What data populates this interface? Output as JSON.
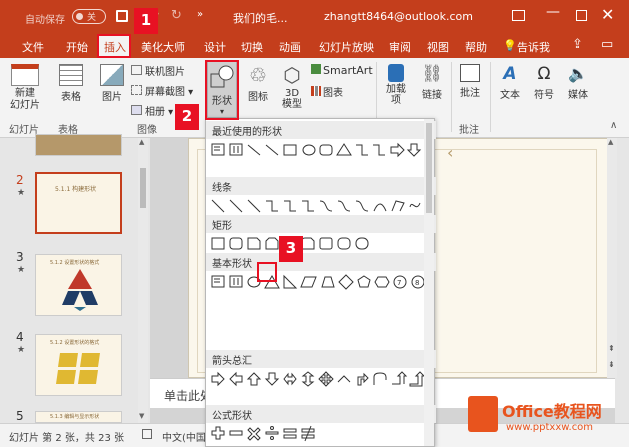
{
  "titlebar": {
    "autosave_label": "自动保存",
    "toggle_label": "关",
    "doc_title": "我们的毛...",
    "account": "zhangtt8464@outlook.com"
  },
  "tabs": [
    "文件",
    "开始",
    "插入",
    "美化大师",
    "设计",
    "切换",
    "动画",
    "幻灯片放映",
    "审阅",
    "视图",
    "帮助",
    "告诉我"
  ],
  "ribbon": {
    "new_slide": "新建\n幻灯片",
    "table": "表格",
    "image": "图片",
    "online_image": "联机图片",
    "screenshot": "屏幕截图",
    "album": "相册",
    "shapes": "形状",
    "icons": "图标",
    "model3d": "3D\n模型",
    "smartart": "SmartArt",
    "chart": "图表",
    "addins": "加载\n项",
    "link": "链接",
    "comment": "批注",
    "text": "文本",
    "symbol": "符号",
    "media": "媒体",
    "group_slides": "幻灯片",
    "group_table": "表格",
    "group_image": "图像",
    "group_comment": "批注"
  },
  "gallery": {
    "cat_recent": "最近使用的形状",
    "cat_lines": "线条",
    "cat_rect": "矩形",
    "cat_basic": "基本形状",
    "cat_arrows": "箭头总汇",
    "cat_formula": "公式形状"
  },
  "slides": {
    "n2": "2",
    "n3": "3",
    "n4": "4",
    "n5": "5",
    "t2": "5.1.1 构建形状",
    "t3": "5.1.2 设置形状的格式",
    "t4": "5.1.2 设置形状的格式",
    "t5": "5.1.3 编辑与显示形状"
  },
  "notes_text": "单击此处",
  "status": {
    "slide_info": "幻灯片 第 2 张，共 23 张",
    "language": "中文(中国"
  },
  "badges": [
    "1",
    "2",
    "3"
  ],
  "watermark": {
    "brand": "Office教程网",
    "url": "www.pptxxw.com"
  },
  "colors": {
    "accent": "#c43e1c",
    "badge": "#e81123"
  }
}
